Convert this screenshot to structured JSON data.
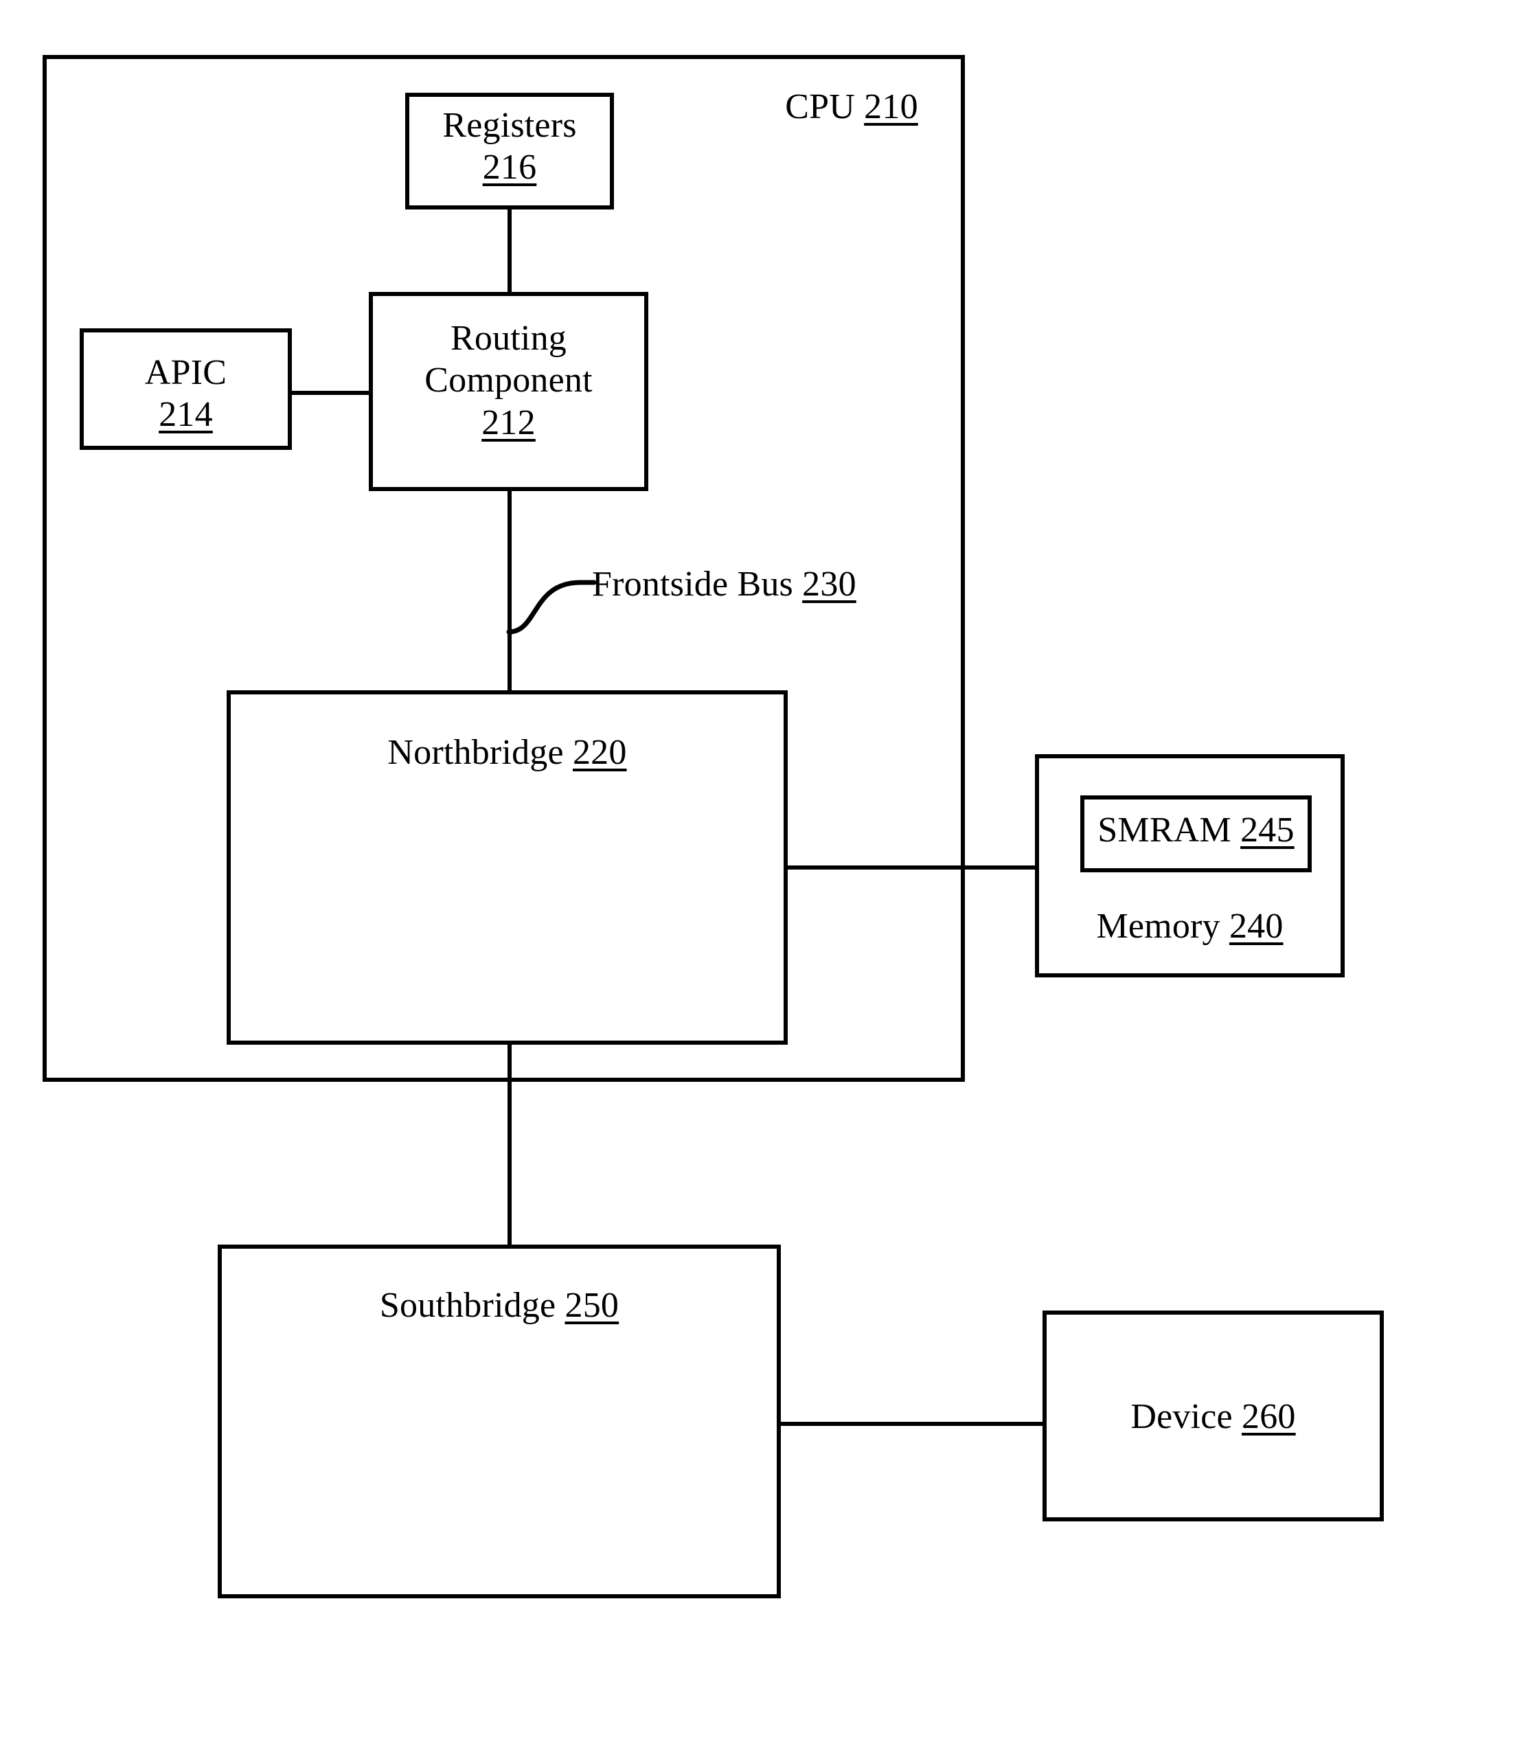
{
  "figure": {
    "type": "patent-block-diagram",
    "background_color": "#ffffff",
    "line_color": "#000000"
  },
  "blocks": {
    "cpu": {
      "name": "CPU",
      "ref": "210",
      "label": "CPU ",
      "number": "210"
    },
    "registers": {
      "name": "Registers",
      "ref": "216",
      "label": "Registers\n",
      "number": "216"
    },
    "routing_component": {
      "name": "Routing Component",
      "ref": "212",
      "label": "Routing\nComponent\n",
      "number": "212"
    },
    "apic": {
      "name": "APIC",
      "ref": "214",
      "label": "APIC\n",
      "number": "214"
    },
    "northbridge": {
      "name": "Northbridge",
      "ref": "220",
      "label": "Northbridge ",
      "number": "220"
    },
    "memory": {
      "name": "Memory",
      "ref": "240",
      "label": "Memory ",
      "number": "240"
    },
    "smram": {
      "name": "SMRAM",
      "ref": "245",
      "label": "SMRAM ",
      "number": "245"
    },
    "southbridge": {
      "name": "Southbridge",
      "ref": "250",
      "label": "Southbridge ",
      "number": "250"
    },
    "device": {
      "name": "Device",
      "ref": "260",
      "label": "Device ",
      "number": "260"
    }
  },
  "connectors": {
    "frontside_bus": {
      "name": "Frontside Bus",
      "ref": "230",
      "label": "Frontside Bus ",
      "number": "230"
    },
    "registers_to_routing": {
      "name": "registers-to-routing-component-link"
    },
    "apic_to_routing": {
      "name": "apic-to-routing-component-link"
    },
    "routing_to_northbridge": {
      "name": "routing-component-to-northbridge-link"
    },
    "northbridge_to_memory": {
      "name": "northbridge-to-memory-link"
    },
    "northbridge_to_southbridge": {
      "name": "northbridge-to-southbridge-link"
    },
    "southbridge_to_device": {
      "name": "southbridge-to-device-link"
    }
  }
}
